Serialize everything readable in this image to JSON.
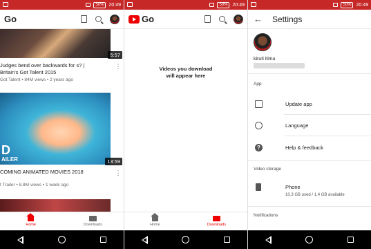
{
  "status_bar": {
    "time": "20:49",
    "battery": "50%"
  },
  "app": {
    "logo_text": "Go"
  },
  "home": {
    "videos": [
      {
        "title": "Judges bend over backwards for s? | Britain's Got Talent 2015",
        "meta": "Got Talent • 84M views • 2 years ago",
        "duration": "5:57"
      },
      {
        "title": "COMING ANIMATED MOVIES 2018",
        "meta": "t Trailer • 8.8M views • 1 week ago",
        "duration": "13:59",
        "thumb_text_big": "D",
        "thumb_text_small": "AILER"
      }
    ]
  },
  "downloads": {
    "empty_message_line1": "Videos you download",
    "empty_message_line2": "will appear here"
  },
  "bottom_nav": {
    "home_label": "Home",
    "downloads_label": "Downloads"
  },
  "settings": {
    "title": "Settings",
    "user_name": "kiruti itimu",
    "section_app": "App",
    "update_app": "Update app",
    "language": "Language",
    "help_feedback": "Help & feedback",
    "section_storage": "Video storage",
    "phone_label": "Phone",
    "phone_storage": "10.3 GB used / 1.4 GB available",
    "section_notifications": "Notifications"
  },
  "colors": {
    "accent": "#e00000",
    "status_bar": "#c62828"
  }
}
